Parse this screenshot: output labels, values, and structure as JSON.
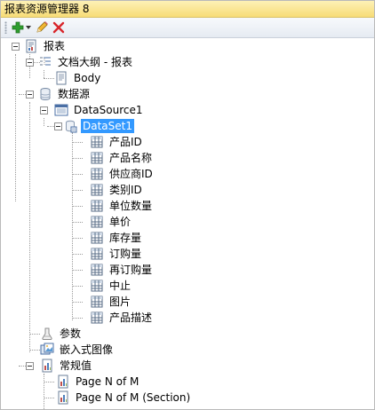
{
  "window": {
    "title": "报表资源管理器 8"
  },
  "toolbar": {
    "items": [
      {
        "icon": "add-icon",
        "has_dropdown": true
      },
      {
        "icon": "pencil-icon"
      },
      {
        "icon": "delete-icon"
      }
    ]
  },
  "tree": {
    "report": {
      "label": "报表"
    },
    "outline": {
      "label": "文档大纲 - 报表"
    },
    "body": {
      "label": "Body"
    },
    "datasources": {
      "label": "数据源"
    },
    "datasource1": {
      "label": "DataSource1"
    },
    "dataset1": {
      "label": "DataSet1",
      "selected": true
    },
    "fields": [
      {
        "label": "产品ID"
      },
      {
        "label": "产品名称"
      },
      {
        "label": "供应商ID"
      },
      {
        "label": "类别ID"
      },
      {
        "label": "单位数量"
      },
      {
        "label": "单价"
      },
      {
        "label": "库存量"
      },
      {
        "label": "订购量"
      },
      {
        "label": "再订购量"
      },
      {
        "label": "中止"
      },
      {
        "label": "图片"
      },
      {
        "label": "产品描述"
      }
    ],
    "parameters": {
      "label": "参数"
    },
    "embedded_images": {
      "label": "嵌入式图像"
    },
    "common_values": {
      "label": "常规值"
    },
    "common_items": [
      {
        "label": "Page N of M"
      },
      {
        "label": "Page N of M (Section)"
      }
    ]
  },
  "colors": {
    "title_bar": "#f7dc77",
    "selection": "#3399ff",
    "add_icon": "#2e9e2e",
    "delete_icon": "#d8262b"
  }
}
